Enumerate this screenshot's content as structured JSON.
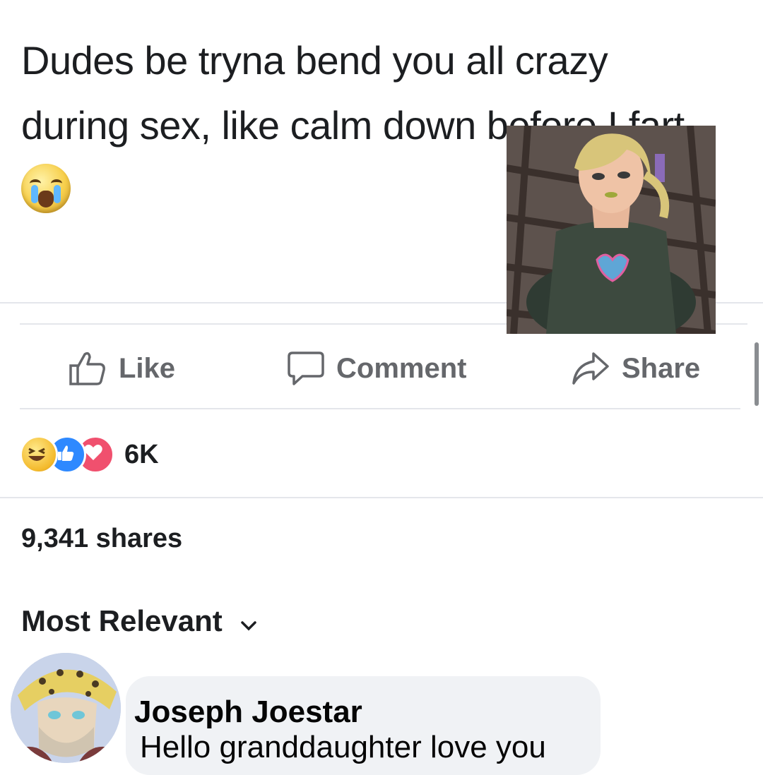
{
  "post": {
    "text_line_1": "Dudes be tryna bend you all crazy",
    "text_line_2": "during sex, like calm down before I fart",
    "emoji": "loudly-crying-face-emoji"
  },
  "actions": {
    "like_label": "Like",
    "comment_label": "Comment",
    "share_label": "Share"
  },
  "reactions": {
    "icons": [
      "haha-reaction-icon",
      "like-reaction-icon",
      "love-reaction-icon"
    ],
    "count": "6K"
  },
  "shares_text": "9,341 shares",
  "sort": {
    "label": "Most Relevant",
    "icon": "chevron-down-icon"
  },
  "comment": {
    "author": "Joseph Joestar",
    "text": "Hello granddaughter love you"
  },
  "colors": {
    "text_primary": "#1c1e21",
    "text_secondary": "#65676b",
    "divider": "#e4e6eb",
    "bubble": "#f0f2f5",
    "like_blue": "#2e89ff",
    "love_red": "#f0506e"
  }
}
